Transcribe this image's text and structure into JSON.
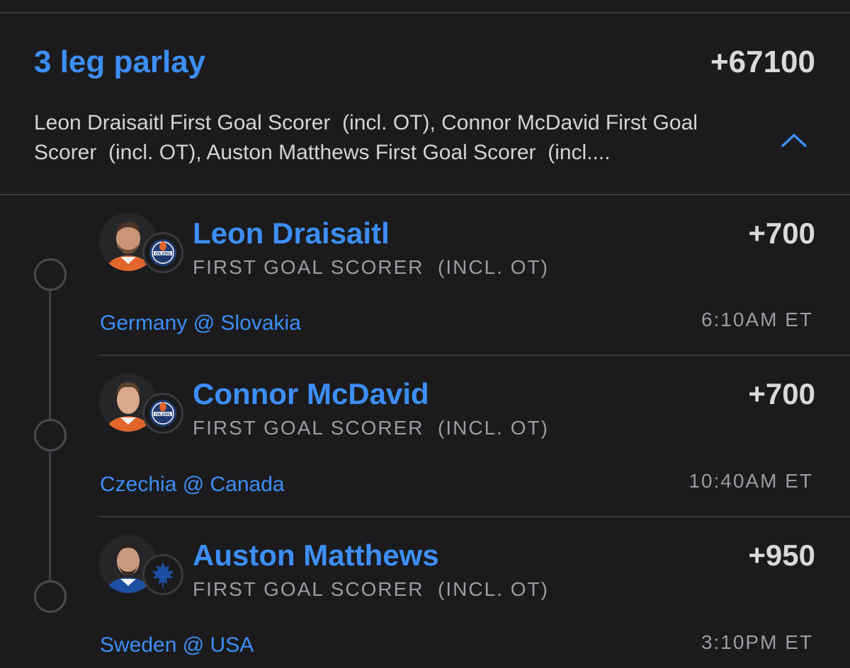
{
  "parlay": {
    "title": "3 leg parlay",
    "odds": "+67100",
    "summary": "Leon Draisaitl First Goal Scorer  (incl. OT), Connor McDavid First Goal Scorer  (incl. OT), Auston Matthews First Goal Scorer  (incl....",
    "collapse_icon": "chevron-up-icon"
  },
  "legs": [
    {
      "player": "Leon Draisaitl",
      "odds": "+700",
      "market": "FIRST GOAL SCORER  (INCL. OT)",
      "matchup": "Germany @ Slovakia",
      "time": "6:10AM ET",
      "team_logo": "oilers-logo-icon"
    },
    {
      "player": "Connor McDavid",
      "odds": "+700",
      "market": "FIRST GOAL SCORER  (INCL. OT)",
      "matchup": "Czechia @ Canada",
      "time": "10:40AM ET",
      "team_logo": "oilers-logo-icon"
    },
    {
      "player": "Auston Matthews",
      "odds": "+950",
      "market": "FIRST GOAL SCORER  (INCL. OT)",
      "matchup": "Sweden @ USA",
      "time": "3:10PM ET",
      "team_logo": "maple-leafs-logo-icon"
    }
  ],
  "colors": {
    "accent": "#3d8ef5",
    "background": "#1b1b1d",
    "primary_text": "#d9d9dc",
    "secondary_text": "#9c9ca1"
  }
}
